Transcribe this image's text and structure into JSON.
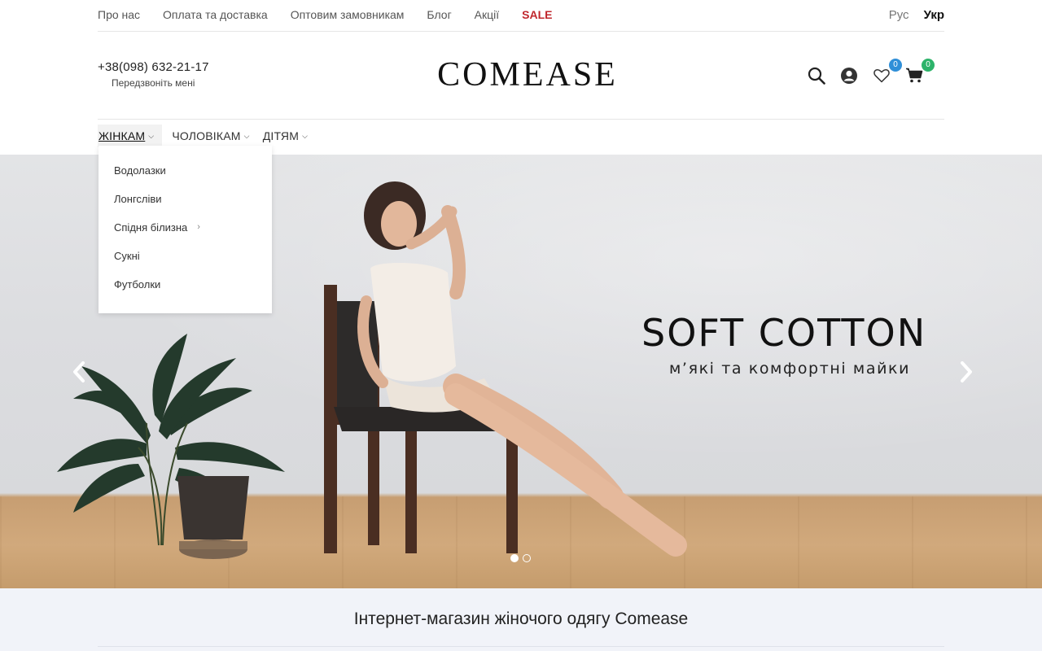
{
  "topbar": {
    "links": [
      "Про нас",
      "Оплата та доставка",
      "Оптовим замовникам",
      "Блог",
      "Акції"
    ],
    "sale": "SALE",
    "languages": [
      "Рус",
      "Укр"
    ],
    "active_language": "Укр"
  },
  "header": {
    "phone": "+38(098) 632-21-17",
    "callback": "Передзвоніть мені",
    "logo": "COMEASE",
    "wishlist_count": "0",
    "cart_count": "0",
    "icons": [
      "search-icon",
      "user-icon",
      "heart-icon",
      "cart-icon"
    ]
  },
  "nav": {
    "items": [
      "ЖІНКАМ",
      "ЧОЛОВІКАМ",
      "ДІТЯМ"
    ],
    "active": "ЖІНКАМ"
  },
  "dropdown": {
    "items": [
      "Водолазки",
      "Лонгсліви",
      "Спідня білизна",
      "Сукні",
      "Футболки"
    ]
  },
  "hero": {
    "title": "SOFT COTTON",
    "subtitle": "м’які та комфортні майки",
    "slides": 2,
    "active_slide": 1
  },
  "section": {
    "title": "Інтернет-магазин жіночого одягу Comease"
  },
  "colors": {
    "sale": "#c0272d",
    "badge_wishlist": "#2f8fd8",
    "badge_cart": "#2db36a",
    "section_bg": "#f1f3f9"
  }
}
